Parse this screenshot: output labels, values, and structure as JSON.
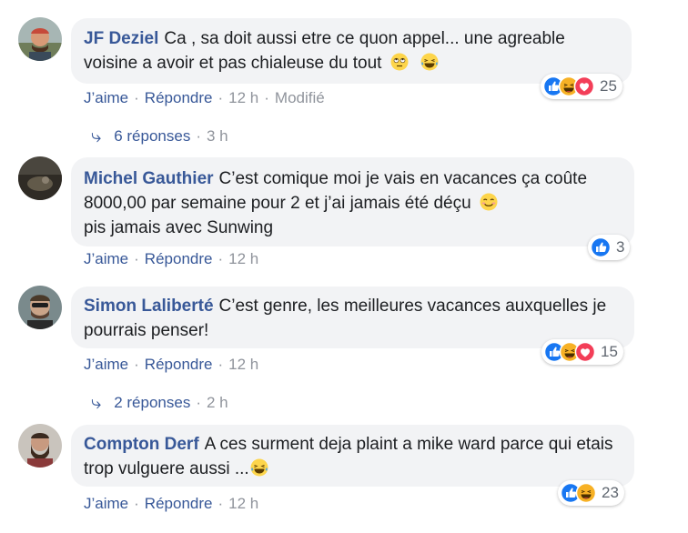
{
  "labels": {
    "like": "J’aime",
    "reply": "Répondre",
    "dot": "·"
  },
  "comments": [
    {
      "author": "JF Deziel",
      "text": "Ca , sa doit aussi etre ce quon appel... une agreable voisine a avoir et pas chialeuse du tout",
      "emojis": [
        "rolling-eyes-emoji",
        "laughing-emoji"
      ],
      "time": "12 h",
      "edited": "Modifié",
      "reactions": [
        "like",
        "haha",
        "love"
      ],
      "reaction_count": "25",
      "replies": {
        "label": "6 réponses",
        "time": "3 h"
      }
    },
    {
      "author": "Michel Gauthier",
      "text": "C’est comique moi je vais en vacances ça coûte 8000,00 par semaine pour 2 et j’ai jamais été déçu",
      "text2": "pis jamais avec Sunwing",
      "emojis": [
        "smiling-emoji"
      ],
      "time": "12 h",
      "reactions": [
        "like"
      ],
      "reaction_count": "3"
    },
    {
      "author": "Simon Laliberté",
      "text": "C’est genre, les meilleures vacances auxquelles je pourrais penser!",
      "time": "12 h",
      "reactions": [
        "like",
        "haha",
        "love"
      ],
      "reaction_count": "15",
      "replies": {
        "label": "2 réponses",
        "time": "2 h"
      }
    },
    {
      "author": "Compton Derf",
      "text": "A ces surment deja plaint a mike ward parce qui etais trop vulguere aussi ...",
      "emojis": [
        "laughing-emoji"
      ],
      "time": "12 h",
      "reactions": [
        "like",
        "haha"
      ],
      "reaction_count": "23"
    }
  ],
  "colors": {
    "link": "#385898",
    "meta": "#90949c",
    "bubble": "#f2f3f5",
    "like": "#1877f2",
    "love": "#f33e58",
    "haha": "#f7b125"
  }
}
